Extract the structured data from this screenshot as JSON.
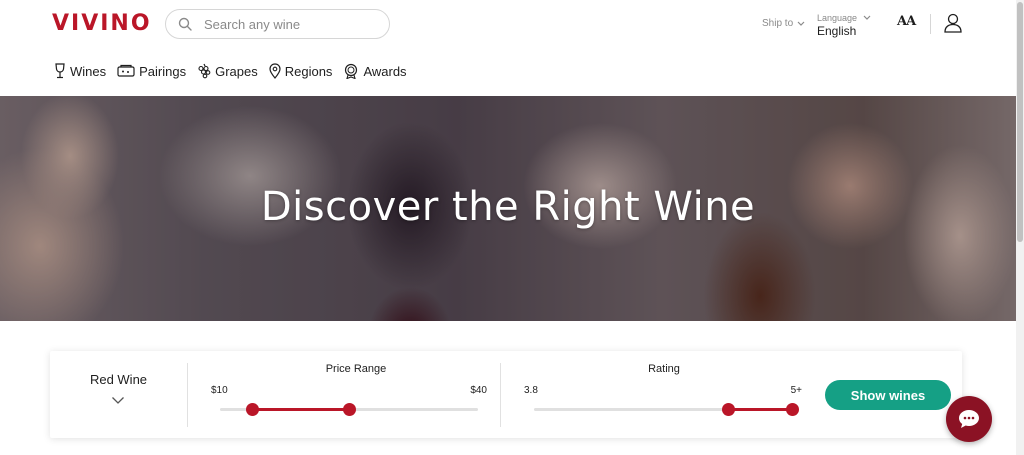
{
  "header": {
    "logo": "VIVINO",
    "search_placeholder": "Search any wine",
    "ship_to_label": "Ship to",
    "language_caption": "Language",
    "language_value": "English",
    "text_size_label": "AA"
  },
  "nav": {
    "items": [
      {
        "label": "Wines",
        "icon": "wine-glass-icon"
      },
      {
        "label": "Pairings",
        "icon": "food-pairing-icon"
      },
      {
        "label": "Grapes",
        "icon": "grapes-icon"
      },
      {
        "label": "Regions",
        "icon": "location-pin-icon"
      },
      {
        "label": "Awards",
        "icon": "award-medal-icon"
      }
    ]
  },
  "hero": {
    "title": "Discover the Right Wine"
  },
  "filter": {
    "wine_type": "Red Wine",
    "price": {
      "title": "Price Range",
      "min_label": "$10",
      "max_label": "$40",
      "min_value": 10,
      "max_value": 40,
      "selected_low_fraction": 0.125,
      "selected_high_fraction": 0.5
    },
    "rating": {
      "title": "Rating",
      "min_label": "3.8",
      "max_label": "5+",
      "selected_low_fraction": 0.75,
      "selected_high_fraction": 1.0
    },
    "show_button": "Show wines"
  },
  "colors": {
    "brand": "#ba1628",
    "button": "#15a085",
    "chat": "#8b1224"
  }
}
